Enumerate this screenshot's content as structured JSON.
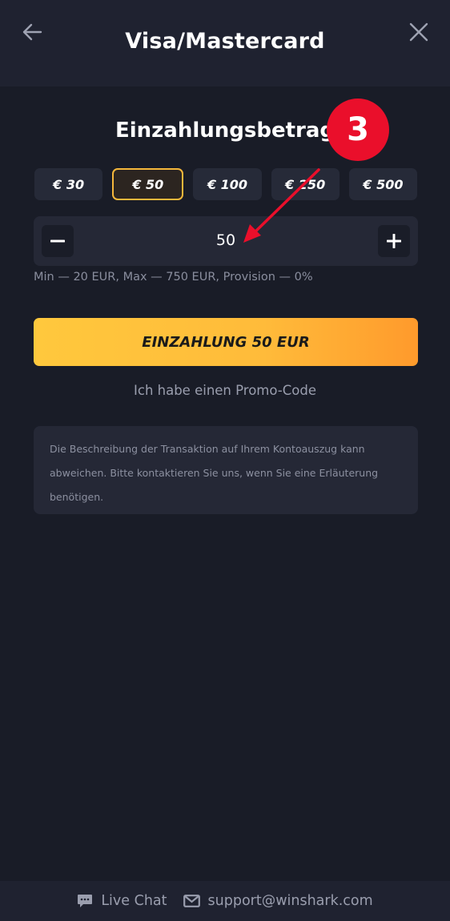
{
  "header": {
    "title": "Visa/Mastercard",
    "back_icon": "back-arrow-icon",
    "close_icon": "close-icon"
  },
  "section": {
    "title": "Einzahlungsbetrag",
    "step_badge": "3"
  },
  "amount_chips": [
    {
      "label": "€ 30",
      "selected": false
    },
    {
      "label": "€ 50",
      "selected": true
    },
    {
      "label": "€ 100",
      "selected": false
    },
    {
      "label": "€ 250",
      "selected": false
    },
    {
      "label": "€ 500",
      "selected": false
    }
  ],
  "stepper": {
    "value": "50",
    "minus_icon": "minus-icon",
    "plus_icon": "plus-icon"
  },
  "limits_text": "Min — 20 EUR, Max — 750 EUR, Provision — 0%",
  "deposit_button": "EINZAHLUNG 50 EUR",
  "promo_link": "Ich habe einen Promo-Code",
  "info_text": "Die Beschreibung der Transaktion auf Ihrem Kontoauszug kann abweichen. Bitte kontaktieren Sie uns, wenn Sie eine Erläuterung benötigen.",
  "footer": {
    "live_chat": "Live Chat",
    "email": "support@winshark.com"
  },
  "colors": {
    "background": "#191c27",
    "accent": "#f5b73b",
    "badge": "#ea0f2b",
    "annotation_arrow": "#ea0f2b"
  }
}
